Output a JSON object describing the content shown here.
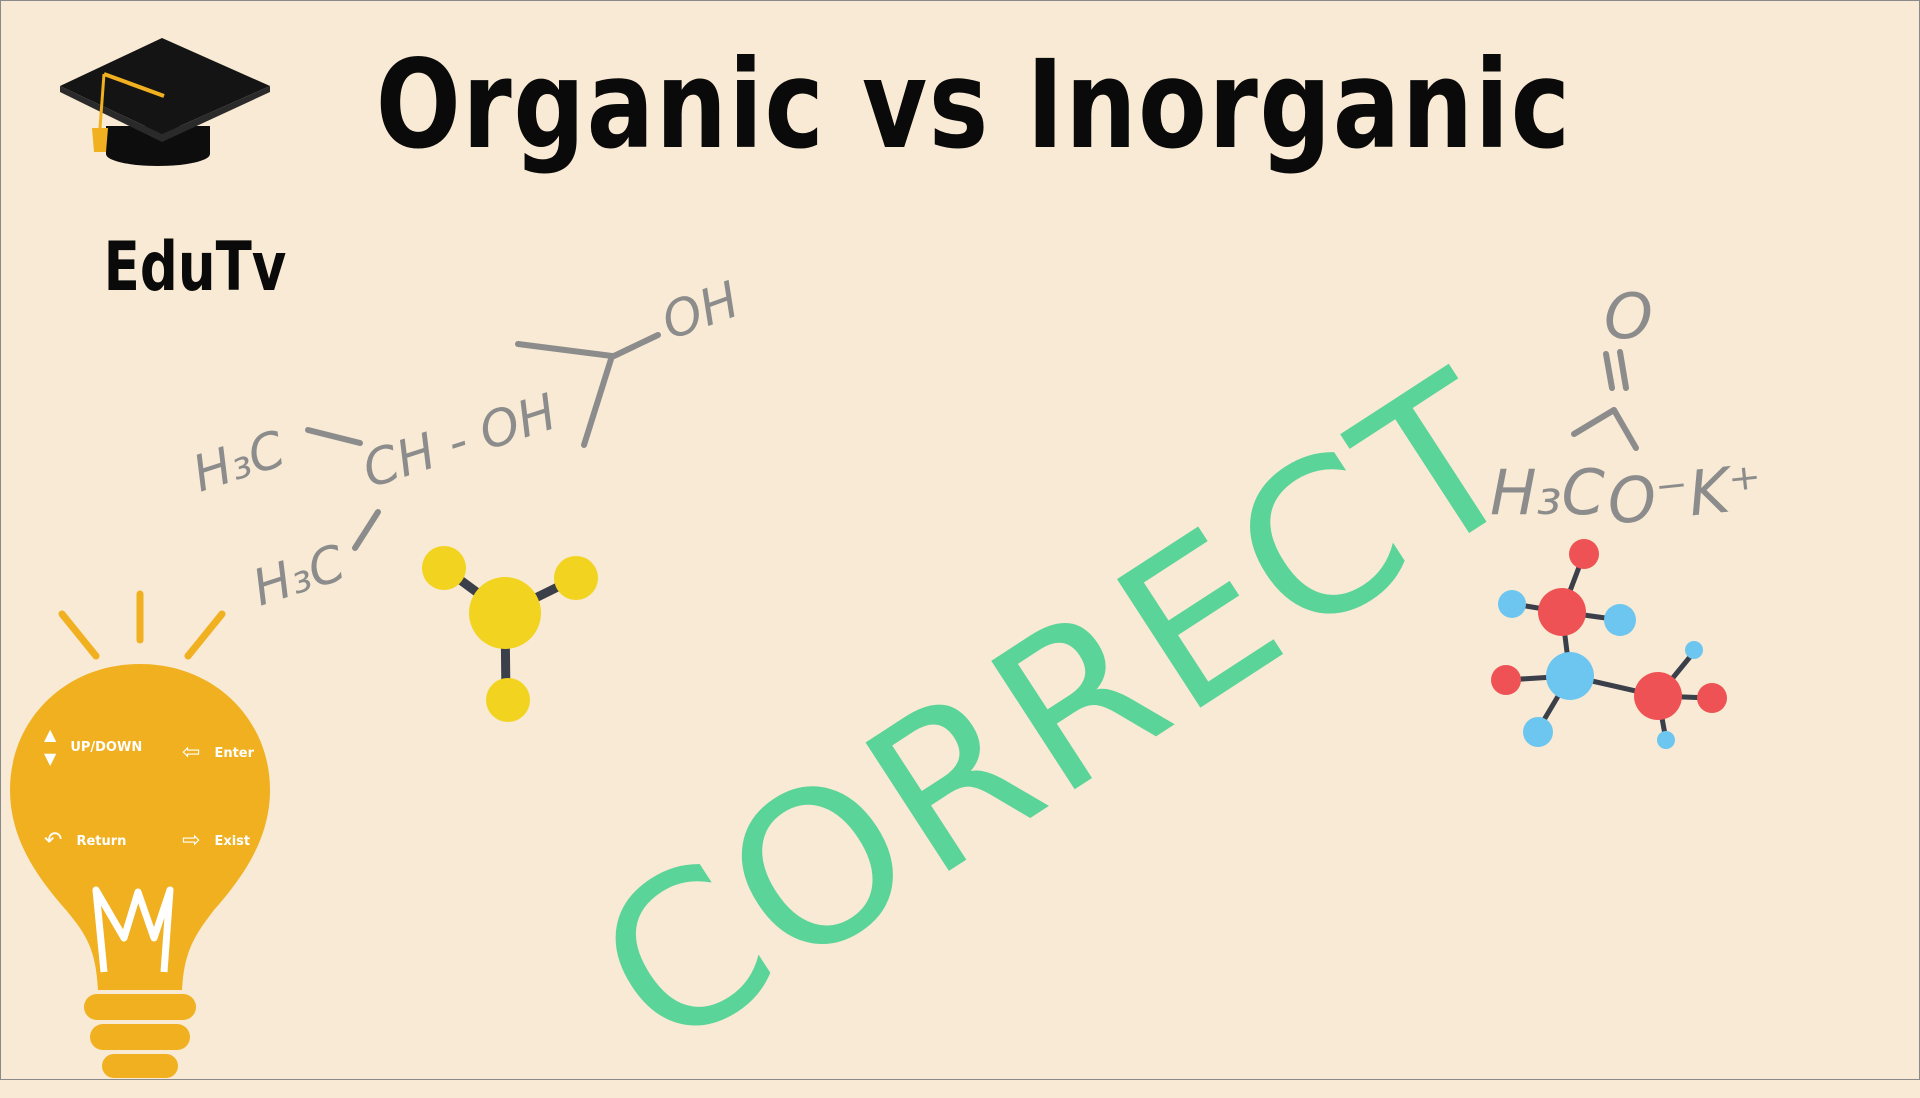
{
  "title": "Organic vs Inorganic",
  "brand": "EduTv",
  "stamp": "CORRECT",
  "left_formula": {
    "oh_top": "OH",
    "ch_oh": "CH - OH",
    "h3c_upper": "H₃C",
    "h3c_lower": "H₃C"
  },
  "right_formula": {
    "oxygen": "O",
    "h3c": "H₃C",
    "salt": "O⁻K⁺"
  },
  "controls": {
    "updown_label": "UP/DOWN",
    "enter_label": "Enter",
    "return_label": "Return",
    "exist_label": "Exist"
  },
  "colors": {
    "background": "#f8ead4",
    "stamp": "#5ad498",
    "bulb": "#f0b020",
    "molecule_yellow": "#f2d320",
    "atom_red": "#ee5254",
    "atom_blue": "#6cc6f0",
    "formula_gray": "#8c8c8c"
  },
  "icons": [
    "graduation-cap-icon",
    "light-bulb-icon",
    "up-arrow-icon",
    "down-arrow-icon",
    "enter-icon",
    "return-icon",
    "exit-icon"
  ]
}
